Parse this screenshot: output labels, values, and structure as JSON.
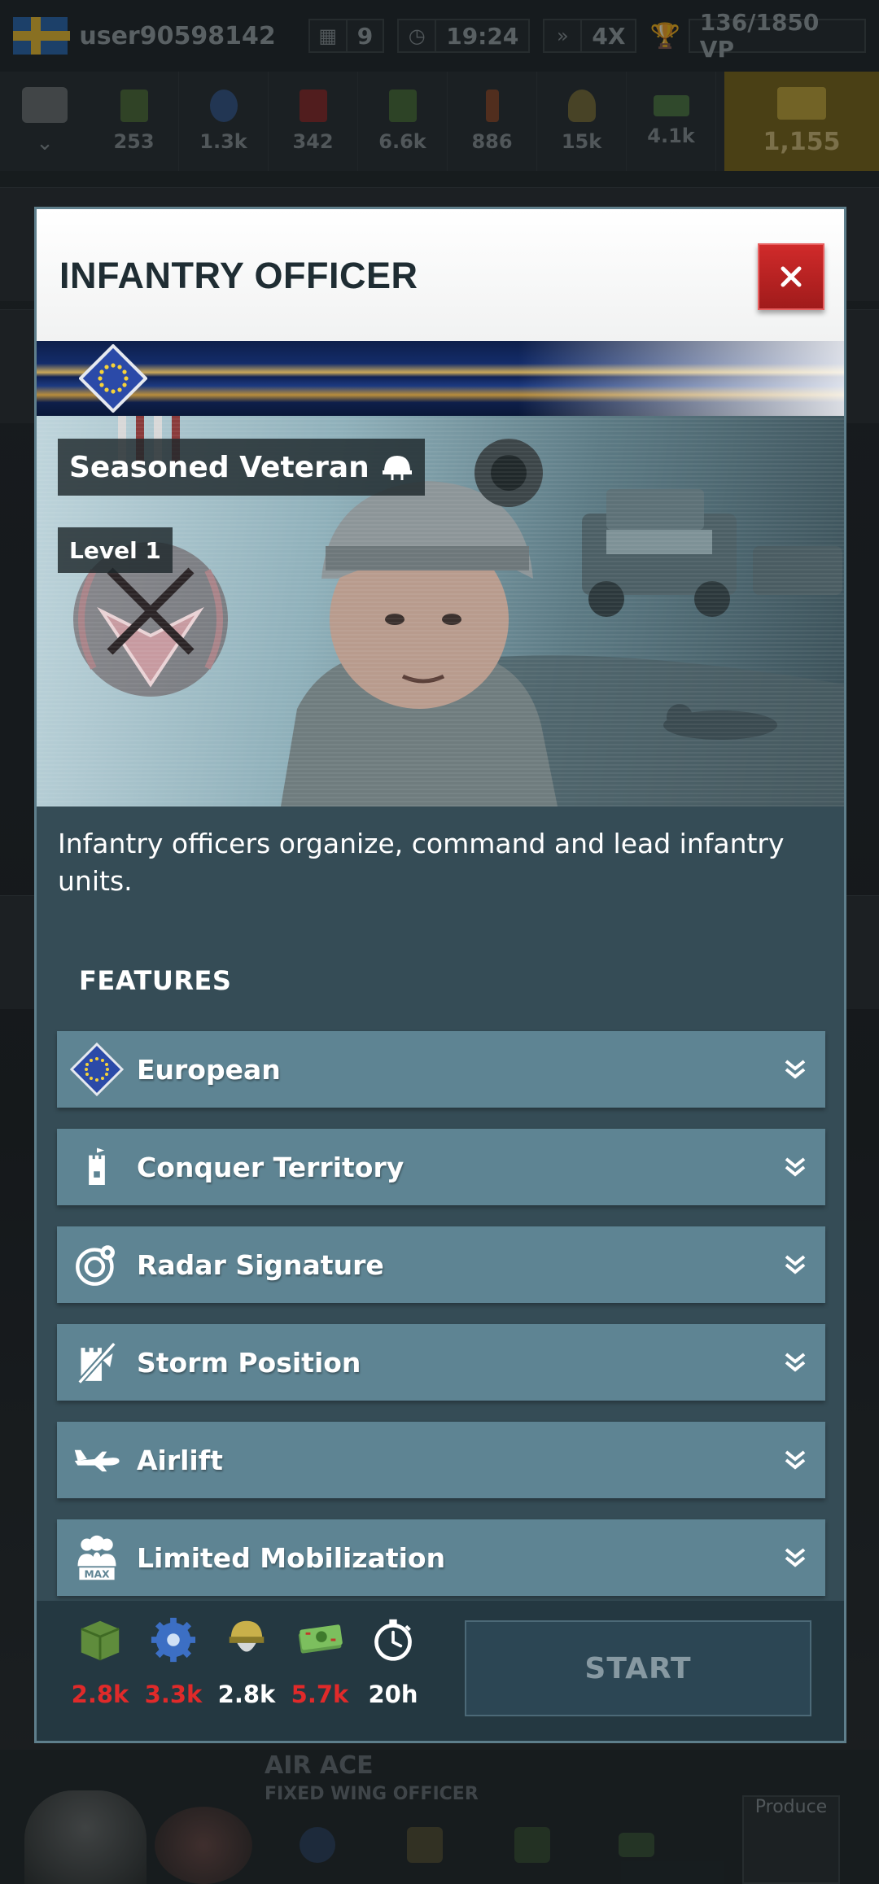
{
  "topbar": {
    "username": "user90598142",
    "day": "9",
    "time": "19:24",
    "speed": "4X",
    "victory_points": "136/1850 VP"
  },
  "resources": [
    {
      "icon": "supplies-icon",
      "value": "253",
      "color": "#5a8a3a"
    },
    {
      "icon": "components-icon",
      "value": "1.3k",
      "color": "#3a6fb8"
    },
    {
      "icon": "fuel-icon",
      "value": "342",
      "color": "#b52a2a"
    },
    {
      "icon": "electronics-icon",
      "value": "6.6k",
      "color": "#4e8a3a"
    },
    {
      "icon": "rare-materials-icon",
      "value": "886",
      "color": "#c0562a"
    },
    {
      "icon": "manpower-icon",
      "value": "15k",
      "color": "#9a8a3a"
    },
    {
      "icon": "money-icon",
      "value": "4.1k",
      "color": "#5a8a4a"
    }
  ],
  "gold": {
    "icon": "gold-icon",
    "value": "1,155"
  },
  "modal": {
    "title": "INFANTRY OFFICER",
    "rank": "Seasoned Veteran",
    "level": "Level 1",
    "description": "Infantry officers organize, command and lead infantry units.",
    "features_title": "FEATURES",
    "features": [
      {
        "label": "European",
        "icon": "eu-flag-icon"
      },
      {
        "label": "Conquer Territory",
        "icon": "tower-flag-icon"
      },
      {
        "label": "Radar Signature",
        "icon": "radar-icon"
      },
      {
        "label": "Storm Position",
        "icon": "storm-position-icon"
      },
      {
        "label": "Airlift",
        "icon": "airlift-plane-icon"
      },
      {
        "label": "Limited Mobilization",
        "icon": "mobilization-max-icon"
      }
    ],
    "costs": [
      {
        "icon": "supplies-icon",
        "value": "2.8k",
        "color": "#e02a2a"
      },
      {
        "icon": "components-icon",
        "value": "3.3k",
        "color": "#e02a2a"
      },
      {
        "icon": "manpower-icon",
        "value": "2.8k",
        "color": "#ffffff"
      },
      {
        "icon": "money-icon",
        "value": "5.7k",
        "color": "#e02a2a"
      },
      {
        "icon": "timer-icon",
        "value": "20h",
        "color": "#ffffff"
      }
    ],
    "start_label": "START"
  },
  "background": {
    "next_title": "AIR ACE",
    "next_subtitle": "FIXED WING OFFICER",
    "produce_label": "Produce"
  }
}
